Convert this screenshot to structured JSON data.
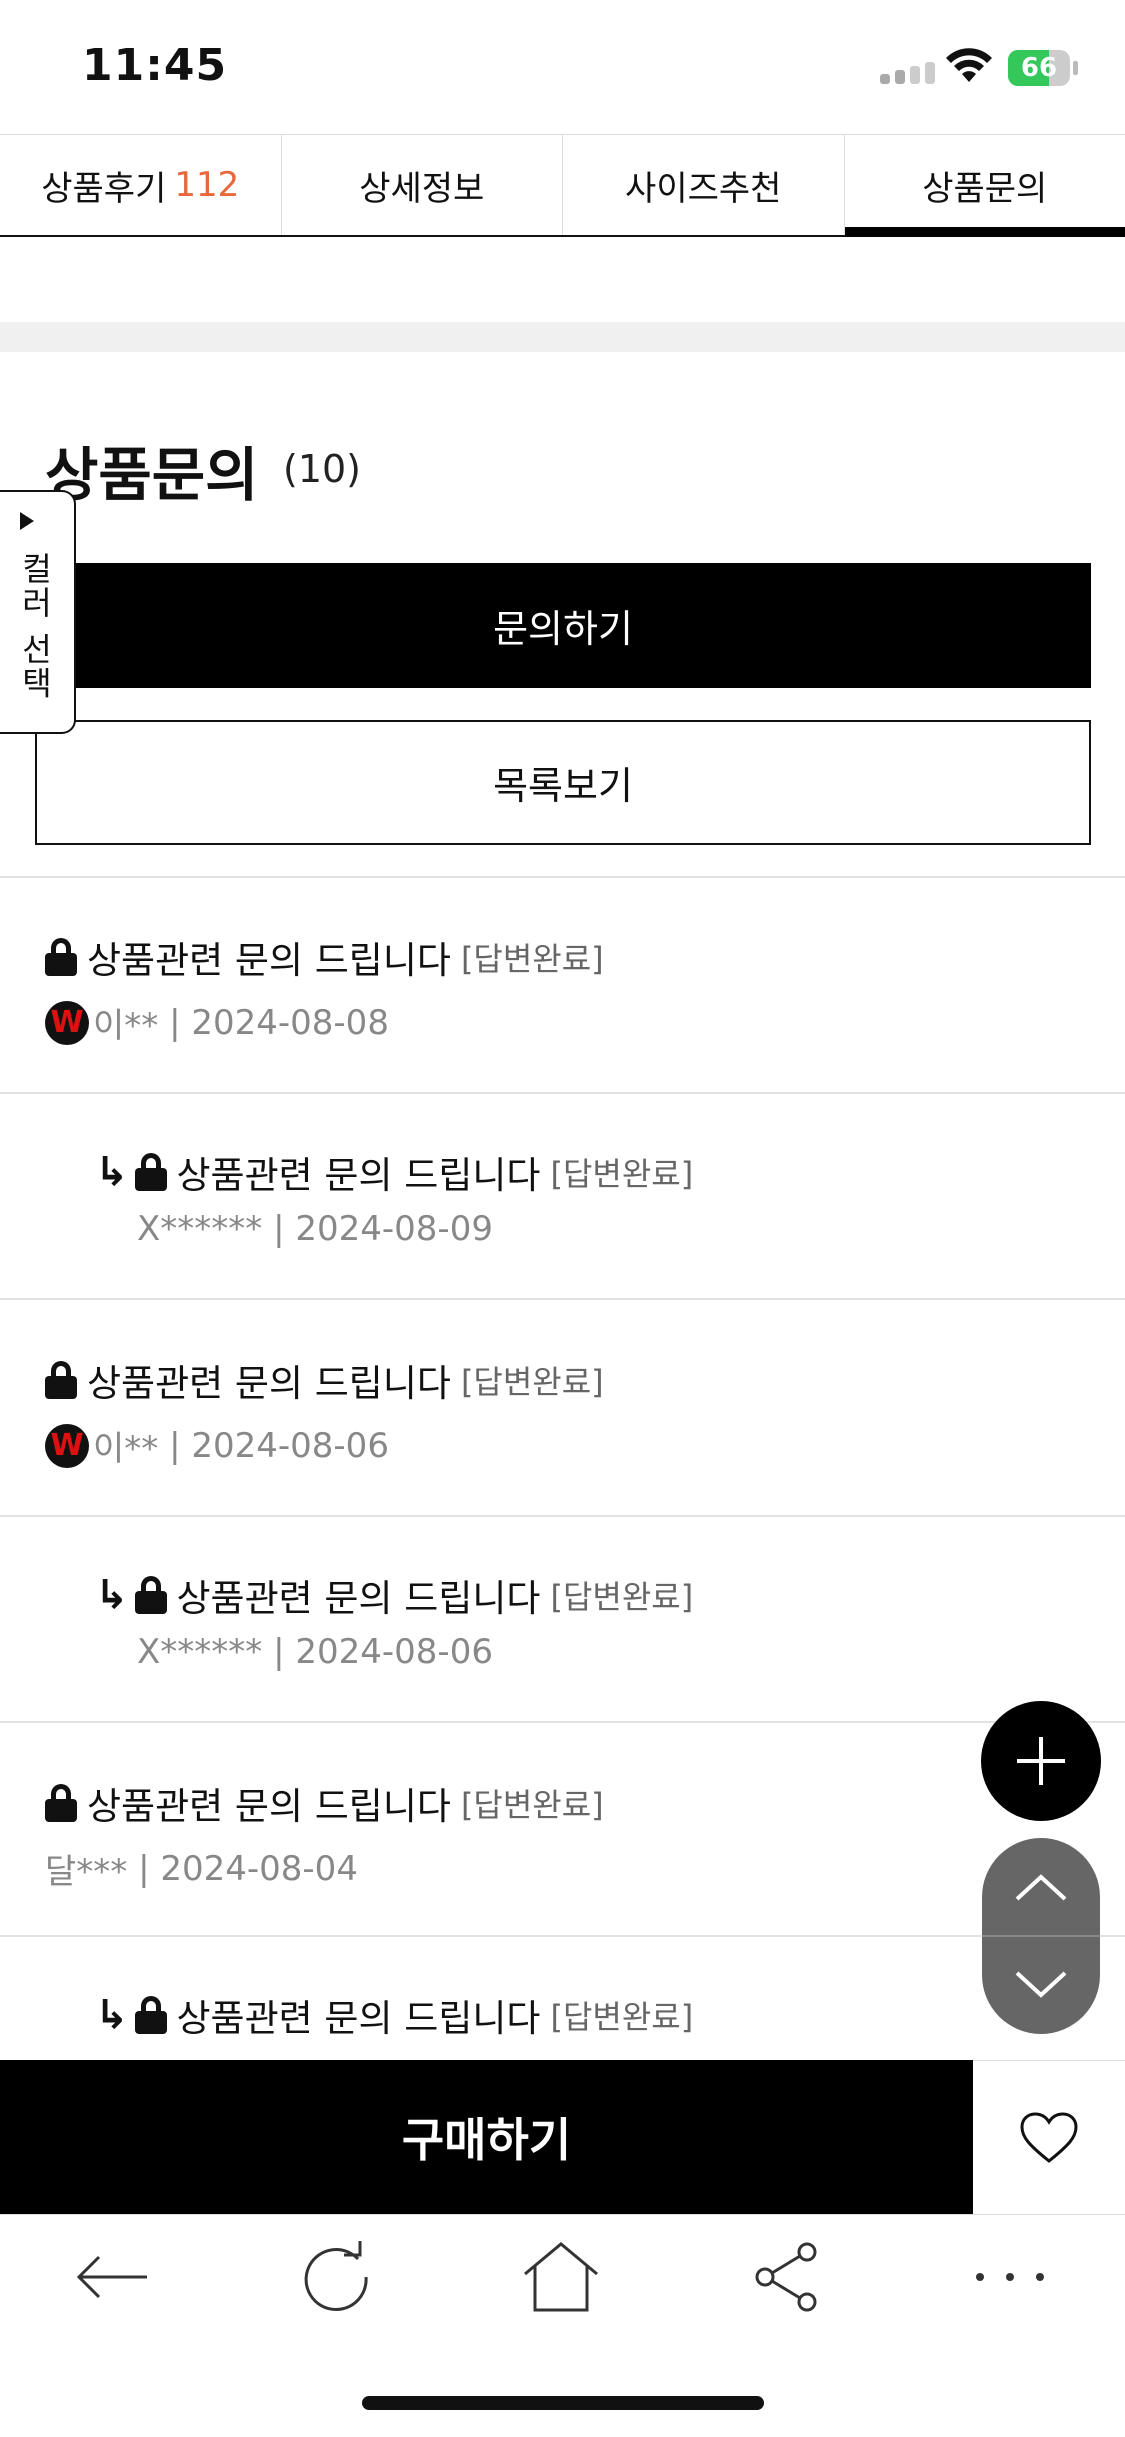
{
  "status_bar": {
    "time": "11:45",
    "battery": "66",
    "battery_level": 0.66
  },
  "tabs": [
    {
      "label": "상품후기",
      "count": "112"
    },
    {
      "label": "상세정보"
    },
    {
      "label": "사이즈추천"
    },
    {
      "label": "상품문의"
    }
  ],
  "section": {
    "title": "상품문의",
    "count": "(10)"
  },
  "buttons": {
    "ask": "문의하기",
    "list": "목록보기",
    "buy": "구매하기"
  },
  "color_tab": {
    "label": "컬러 선택"
  },
  "inquiries": [
    {
      "title": "상품관련 문의 드립니다",
      "status": "[답변완료]",
      "author": "이**",
      "date": "| 2024-08-08",
      "badge": "W"
    },
    {
      "title": "상품관련 문의 드립니다",
      "status": "[답변완료]",
      "author": "X******",
      "date": "| 2024-08-09",
      "reply_arrow": "↳"
    },
    {
      "title": "상품관련 문의 드립니다",
      "status": "[답변완료]",
      "author": "이**",
      "date": "| 2024-08-06",
      "badge": "W"
    },
    {
      "title": "상품관련 문의 드립니다",
      "status": "[답변완료]",
      "author": "X******",
      "date": "| 2024-08-06",
      "reply_arrow": "↳"
    },
    {
      "title": "상품관련 문의 드립니다",
      "status": "[답변완료]",
      "author": "달***",
      "date": "| 2024-08-04"
    },
    {
      "title": "상품관련 문의 드립니다",
      "status": "[답변완료]",
      "reply_arrow": "↳"
    }
  ],
  "icons": {
    "lock": "lock-icon",
    "reply": "reply-arrow-icon",
    "plus": "plus-icon",
    "up": "chevron-up-icon",
    "down": "chevron-down-icon",
    "heart": "heart-icon",
    "back": "back-arrow-icon",
    "refresh": "refresh-icon",
    "home": "home-icon",
    "share": "share-icon",
    "more": "more-icon"
  },
  "colors": {
    "accent": "#e8683c",
    "primary": "#000000",
    "battery": "#34c759"
  }
}
